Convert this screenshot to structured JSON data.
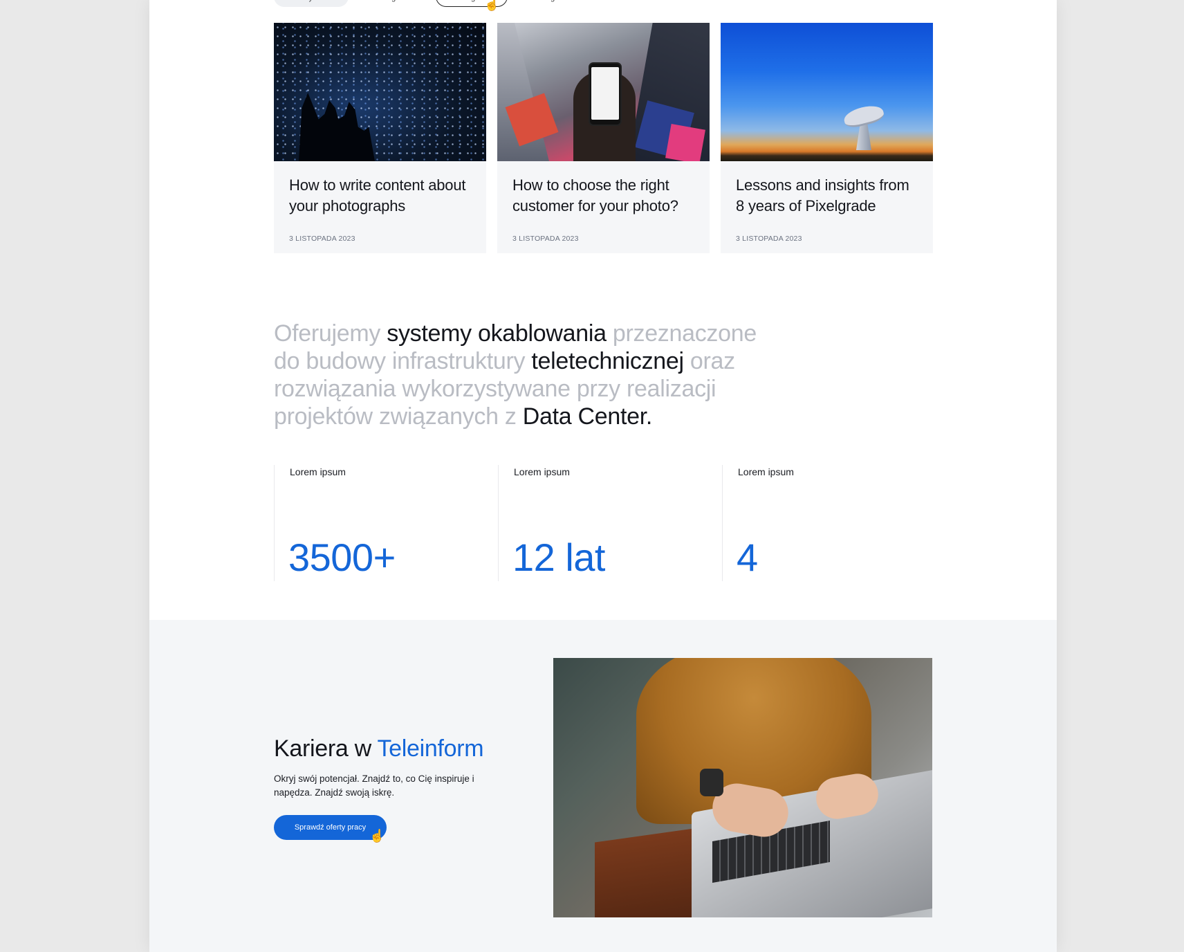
{
  "filters": {
    "tabs": [
      "Wszystkie",
      "Kategoria",
      "Kategoria",
      "Kategoria"
    ],
    "active_index": 2
  },
  "posts": [
    {
      "title": "How to write content about your photographs",
      "date": "3 LISTOPADA 2023"
    },
    {
      "title": "How to choose the right customer for your photo?",
      "date": "3 LISTOPADA 2023"
    },
    {
      "title": "Lessons and insights from 8 years of Pixelgrade",
      "date": "3 LISTOPADA 2023"
    }
  ],
  "statement": {
    "p1": "Oferujemy ",
    "h1": "systemy okablowania",
    "p2": " przeznaczone do budowy infrastruktury ",
    "h2": "teletechnicznej",
    "p3": " oraz rozwiązania wykorzystywane przy realizacji projektów związanych z ",
    "h3": "Data Center."
  },
  "stats": [
    {
      "label": "Lorem ipsum",
      "value": "3500+"
    },
    {
      "label": "Lorem ipsum",
      "value": "12 lat"
    },
    {
      "label": "Lorem ipsum",
      "value": "4"
    }
  ],
  "career": {
    "heading_prefix": "Kariera w ",
    "heading_brand": "Teleinform",
    "description": "Okryj swój potencjał. Znajdź to, co Cię inspiruje i napędza. Znajdź swoją iskrę.",
    "cta_label": "Sprawdź oferty pracy"
  },
  "colors": {
    "accent": "#1466d8",
    "muted_text": "#b9bcc3",
    "section_bg": "#f4f6f8"
  }
}
